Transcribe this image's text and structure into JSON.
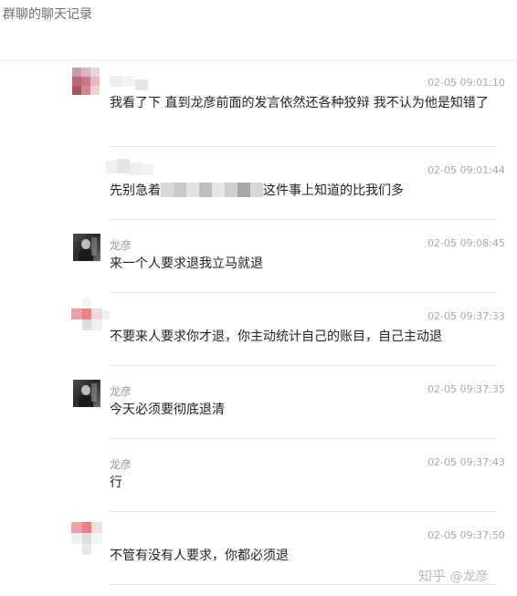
{
  "window": {
    "title": "群聊的聊天记录"
  },
  "messages": [
    {
      "name": "",
      "time": "02-05 09:01:10",
      "text": "我看了下 直到龙彦前面的发言依然还各种狡辩 我不认为他是知错了"
    },
    {
      "name": "",
      "time": "02-05 09:01:44",
      "text_before": "先别急着",
      "text_after": "这件事上知道的比我们多"
    },
    {
      "name": "龙彦",
      "time": "02-05 09:08:45",
      "text": "来一个人要求退我立马就退"
    },
    {
      "name": "",
      "time": "02-05 09:37:33",
      "text": "不要来人要求你才退，你主动统计自己的账目，自己主动退"
    },
    {
      "name": "龙彦",
      "time": "02-05 09:37:35",
      "text": "今天必须要彻底退清"
    },
    {
      "name": "龙彦",
      "time": "02-05 09:37:43",
      "text": "行"
    },
    {
      "name": "",
      "time": "02-05 09:37:50",
      "text": "不管有没有人要求，你都必须退"
    }
  ],
  "watermark": {
    "brand": "知乎",
    "user": "@龙彦"
  }
}
